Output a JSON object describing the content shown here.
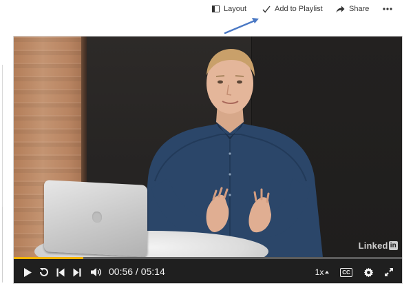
{
  "toolbar": {
    "layout_label": "Layout",
    "playlist_label": "Add to Playlist",
    "share_label": "Share",
    "more_icon": "more-horizontal-icon",
    "icons": {
      "layout": "layout-icon",
      "playlist": "checkmark-icon",
      "share": "share-arrow-icon"
    }
  },
  "annotation": {
    "color": "#4a78c4",
    "icon": "annotation-arrow"
  },
  "player": {
    "watermark": "Linked",
    "watermark_in": "in",
    "progress": {
      "current": "00:56",
      "duration": "05:14",
      "separator": " / "
    },
    "speed": "1x",
    "cc_label": "CC",
    "accent_color": "#f4b400",
    "icons": {
      "play": "play-icon",
      "replay": "replay-icon",
      "previous": "skip-previous-icon",
      "next": "skip-next-icon",
      "volume": "volume-icon",
      "speed_caret": "caret-up-icon",
      "settings": "gear-icon",
      "fullscreen": "fullscreen-icon"
    }
  }
}
